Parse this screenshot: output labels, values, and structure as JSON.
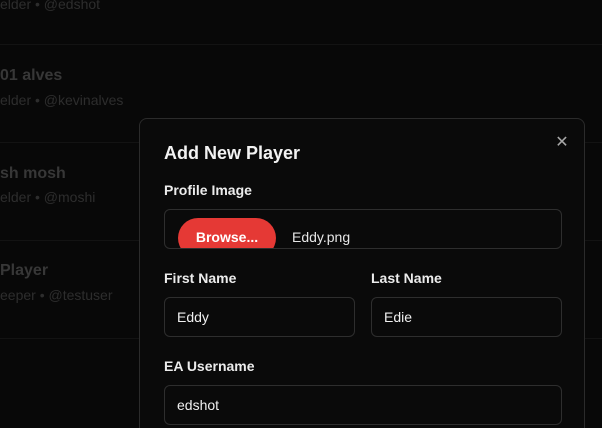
{
  "background_list": {
    "rows": [
      {
        "name": "",
        "meta": "elder • @edshot"
      },
      {
        "name": "01 alves",
        "meta": "elder • @kevinalves"
      },
      {
        "name": "sh mosh",
        "meta": "elder • @moshi"
      },
      {
        "name": "Player",
        "meta": "eeper • @testuser"
      }
    ]
  },
  "modal": {
    "title": "Add New Player",
    "close_glyph": "✕",
    "profile_image": {
      "label": "Profile Image",
      "browse_label": "Browse...",
      "file_name": "Eddy.png"
    },
    "first_name": {
      "label": "First Name",
      "value": "Eddy"
    },
    "last_name": {
      "label": "Last Name",
      "value": "Edie"
    },
    "ea_username": {
      "label": "EA Username",
      "value": "edshot"
    }
  },
  "colors": {
    "accent": "#e53935",
    "background": "#0b0b0b",
    "modal_border": "#2b2b2b"
  }
}
